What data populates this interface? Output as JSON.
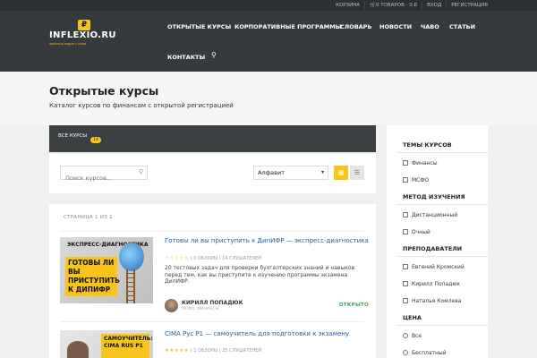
{
  "topbar": {
    "cart": "КОРЗИНА",
    "cart_items": "0 ТОВАРОВ - 0 ₽",
    "login": "ВХОД",
    "register": "РЕГИСТРАЦИЯ"
  },
  "logo": {
    "name": "INFLEXIO.RU",
    "glyph": "₽",
    "tagline": "ФИНАНСЫ РЯДОМ С НАМИ"
  },
  "nav": {
    "items": [
      "ОТКРЫТЫЕ КУРСЫ",
      "КОРПОРАТИВНЫЕ ПРОГРАММЫ",
      "СЛОВАРЬ",
      "НОВОСТИ",
      "ЧАВО",
      "СТАТЬИ",
      "КОНТАКТЫ"
    ],
    "search_icon": "search-icon"
  },
  "page": {
    "title": "Открытые курсы",
    "subtitle": "Каталог курсов по финансам с открытой регистрацией"
  },
  "filters": {
    "all_label": "ВСЕ КУРСЫ",
    "count": "14"
  },
  "toolbar": {
    "search_placeholder": "Поиск курсов...",
    "sort_value": "Алфавит"
  },
  "listing": {
    "pager": "СТРАНИЦА 1 ИЗ 1",
    "courses": [
      {
        "image_caption": "ЭКСПРЕСС-ДИАГНОСТИКА",
        "image_text": "ГОТОВЫ ЛИ ВЫ ПРИСТУПИТЬ К ДИПИФР",
        "title": "Готовы ли вы приступить к ДипИФР — экспресс-диагностика",
        "stars": "☆☆☆☆☆",
        "meta": "( 0 ОБЗОРЫ ) 14 СЛУШАТЕЛЕЙ",
        "description": "20 тестовых задач для проверки бухгалтерских знаний и навыков перед тем, как вы приступите к изучению программы экзамена ДипИФР.",
        "author": "КИРИЛЛ ПОПАДЮК",
        "category": "МСФО, ФИНАНСЫ",
        "status": "ОТКРЫТО"
      },
      {
        "image_text": "САМОУЧИТЕЛЬ: CIMA RUS P1",
        "title": "CIMA Рус P1 — самоучитель для подготовки к экзамену",
        "stars": "★★★★★",
        "meta": "( 1 ОБЗОРЫ ) 25 СЛУШАТЕЛЕЙ"
      }
    ]
  },
  "sidebar": {
    "sections": [
      {
        "title": "ТЕМЫ КУРСОВ",
        "options": [
          "Финансы",
          "МСФО"
        ]
      },
      {
        "title": "МЕТОД ИЗУЧЕНИЯ",
        "options": [
          "Дистанционный",
          "Очный"
        ]
      },
      {
        "title": "ПРЕПОДАВАТЕЛИ",
        "options": [
          "Евгений Кромский",
          "Кирилл Попадюк",
          "Наталья Комлева"
        ]
      },
      {
        "title": "ЦЕНА",
        "options": [
          "Все",
          "Бесплатный"
        ]
      }
    ]
  },
  "colors": {
    "accent": "#f6c41b",
    "header": "#363a3d",
    "link": "#1e5f9a",
    "status_open": "#3aa34a"
  }
}
